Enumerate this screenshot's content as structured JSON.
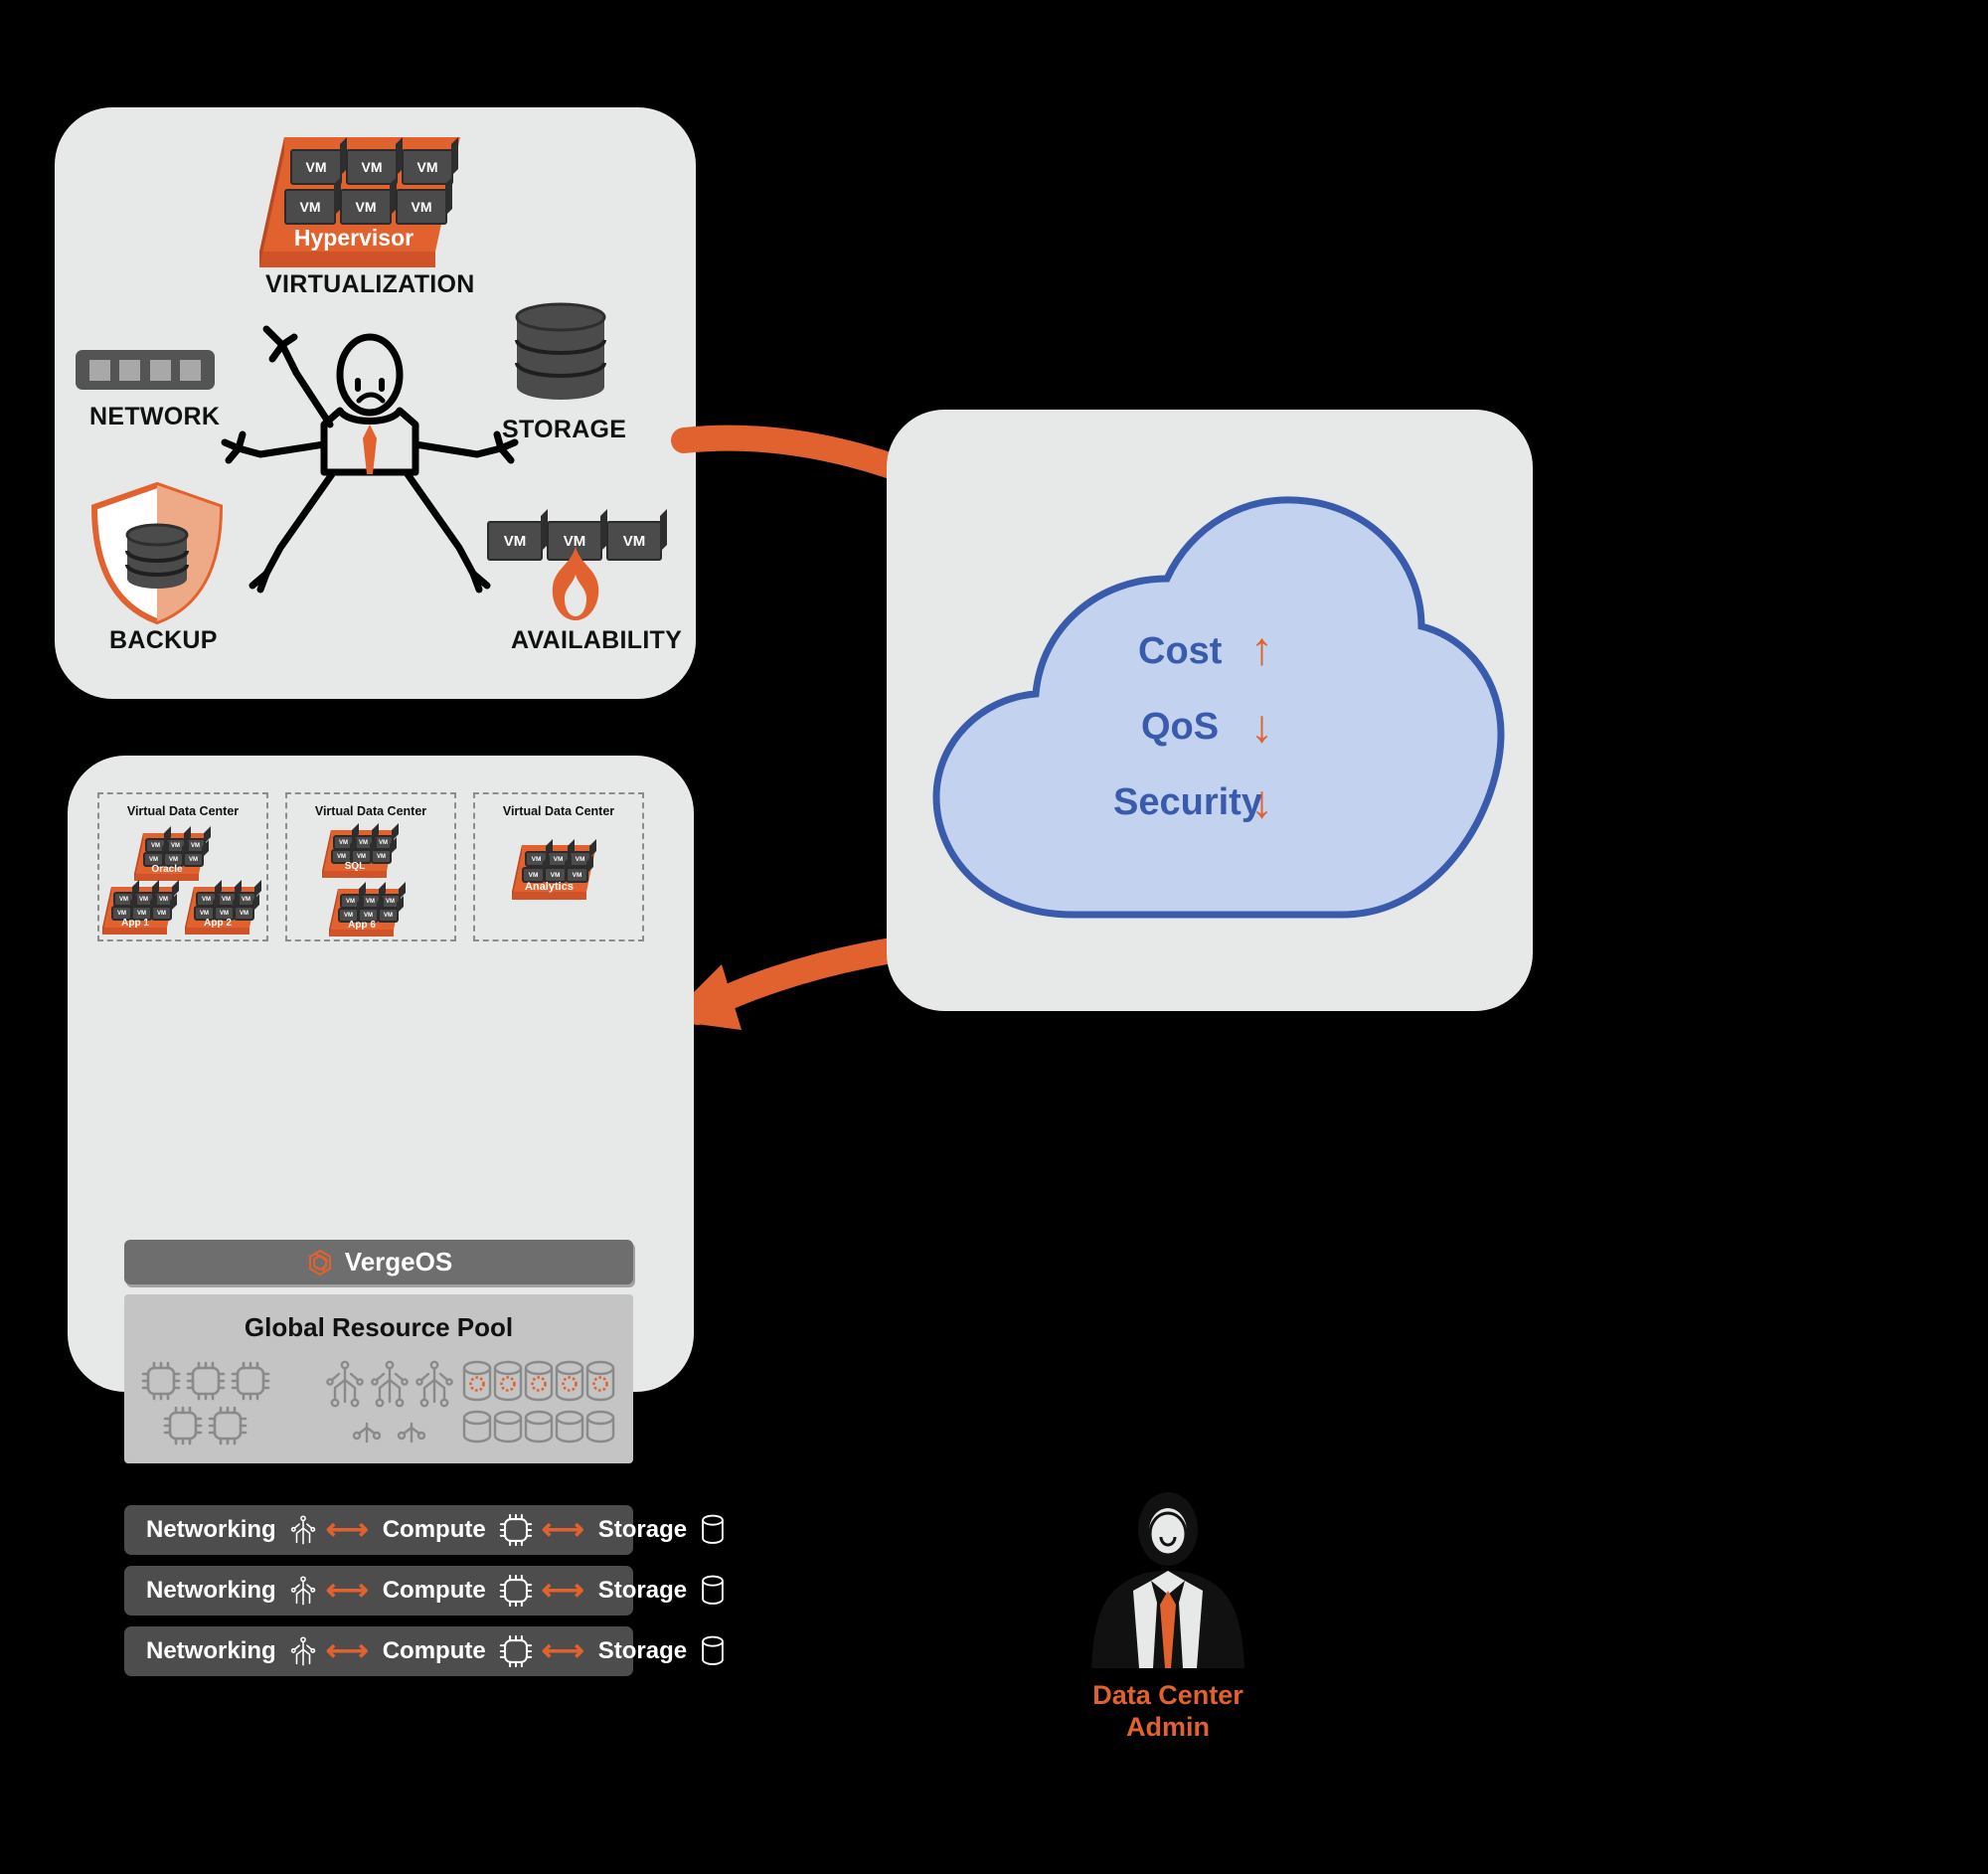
{
  "meta": {
    "background_color": "#000000",
    "panel_color": "#e7e9e8",
    "accent_orange": "#e2622f",
    "cloud_fill": "#c3d3ef",
    "cloud_stroke": "#3a5bab",
    "dark_gray": "#4b4b4b"
  },
  "legacy_panel": {
    "virtualization": {
      "label": "VIRTUALIZATION",
      "slab_label": "Hypervisor",
      "vm_label": "VM",
      "vm_count": 6
    },
    "network": {
      "label": "NETWORK",
      "icon": "network-switch-icon",
      "port_count": 4
    },
    "storage": {
      "label": "STORAGE",
      "icon": "database-stack-icon"
    },
    "backup": {
      "label": "BACKUP",
      "icon": "shield-database-icon"
    },
    "availability": {
      "label": "AVAILABILITY",
      "icon": "fire-vm-icon",
      "vm_label": "VM",
      "vm_count": 3
    },
    "person": {
      "icon": "stressed-admin-figure-icon"
    }
  },
  "cloud_panel": {
    "items": [
      {
        "label": "Cost",
        "arrow": "↑",
        "direction": "up"
      },
      {
        "label": "QoS",
        "arrow": "↓",
        "direction": "down"
      },
      {
        "label": "Security",
        "arrow": "↓",
        "direction": "down"
      }
    ]
  },
  "arrows": {
    "to_cloud": "arrow-right-to-cloud",
    "from_cloud": "arrow-left-from-cloud"
  },
  "verge_panel": {
    "vdcs": [
      {
        "title": "Virtual Data Center",
        "stacks": [
          {
            "name": "Oracle",
            "vm_label": "VM",
            "vm_count": 6
          },
          {
            "name": "App 1",
            "vm_label": "VM",
            "vm_count": 6
          },
          {
            "name": "App 2",
            "vm_label": "VM",
            "vm_count": 6
          }
        ]
      },
      {
        "title": "Virtual Data Center",
        "stacks": [
          {
            "name": "SQL",
            "vm_label": "VM",
            "vm_count": 6
          },
          {
            "name": "App 6",
            "vm_label": "VM",
            "vm_count": 6
          }
        ]
      },
      {
        "title": "Virtual Data Center",
        "stacks": [
          {
            "name": "Analytics",
            "vm_label": "VM",
            "vm_count": 6
          }
        ]
      }
    ],
    "os_bar": {
      "label": "VergeOS",
      "icon": "vergeos-logo-icon"
    },
    "resource_pool": {
      "title": "Global Resource Pool",
      "groups": [
        {
          "icon": "cpu-chip-icon",
          "count": 5
        },
        {
          "icon": "network-circuit-icon",
          "count": 5
        },
        {
          "icon": "disk-cylinder-icon",
          "count": 10
        }
      ]
    },
    "hw_rows": [
      {
        "networking": "Networking",
        "compute": "Compute",
        "storage": "Storage"
      },
      {
        "networking": "Networking",
        "compute": "Compute",
        "storage": "Storage"
      },
      {
        "networking": "Networking",
        "compute": "Compute",
        "storage": "Storage"
      }
    ],
    "hw_icons": {
      "networking": "network-circuit-icon",
      "compute": "cpu-chip-icon",
      "storage": "disk-cylinder-icon",
      "link": "double-arrow-icon"
    }
  },
  "admin": {
    "icon": "business-person-icon",
    "line1": "Data Center",
    "line2": "Admin"
  }
}
